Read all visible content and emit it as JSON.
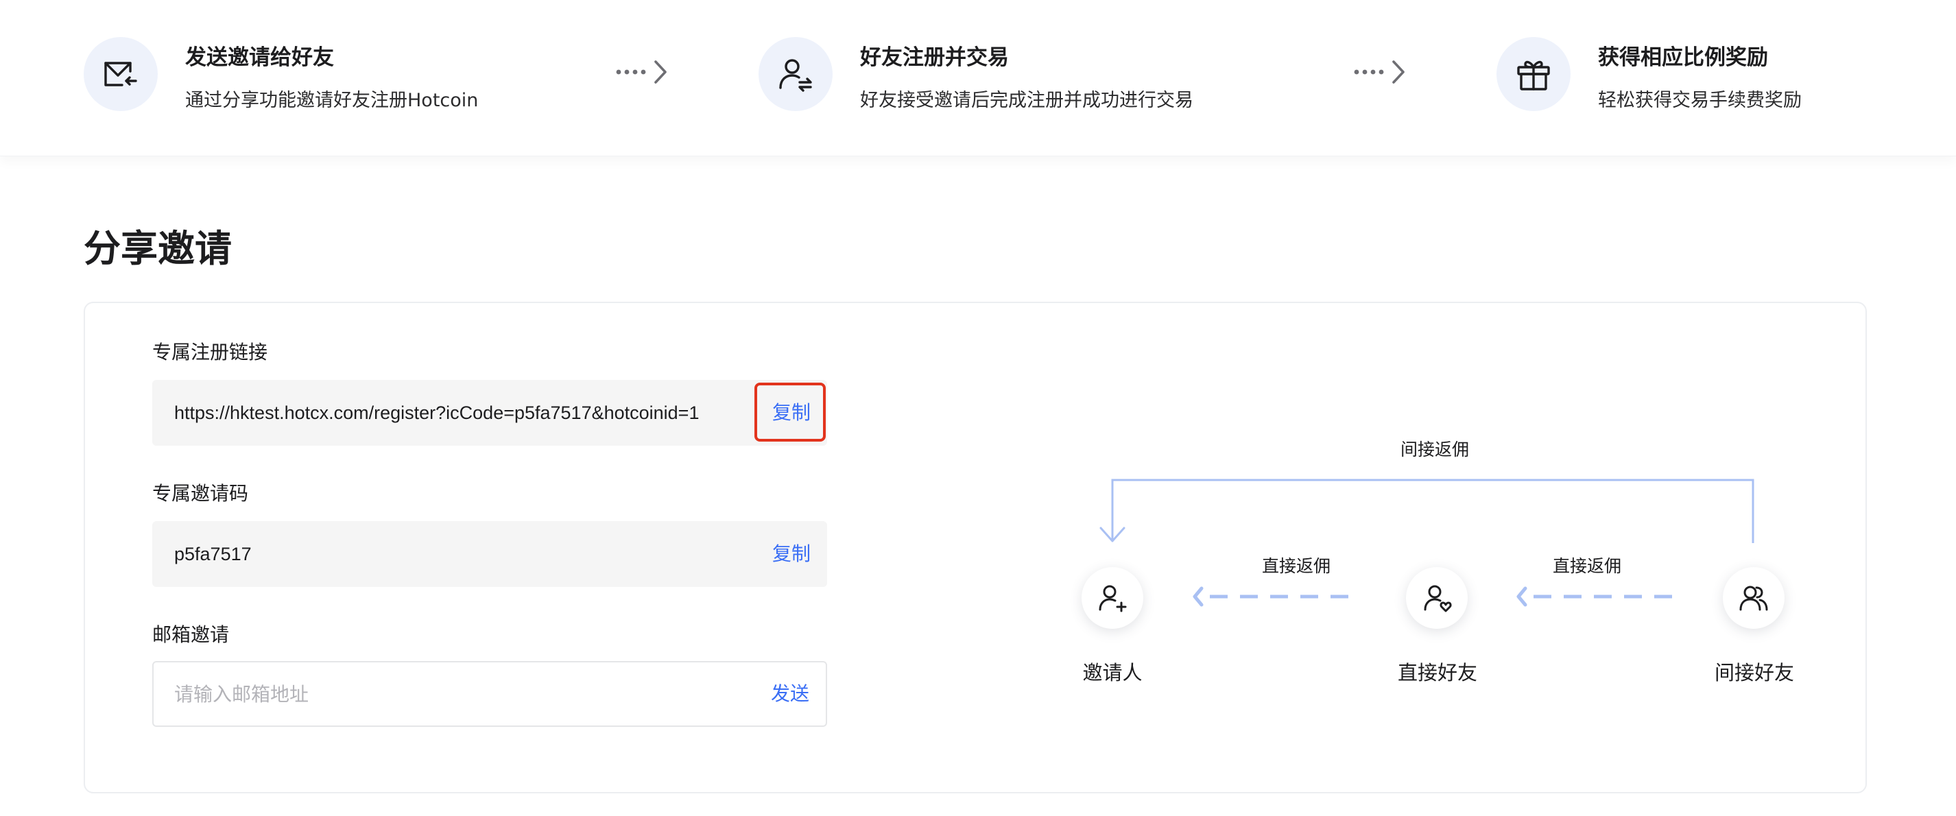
{
  "steps": [
    {
      "icon": "mail-send-icon",
      "title": "发送邀请给好友",
      "desc": "通过分享功能邀请好友注册Hotcoin"
    },
    {
      "icon": "user-exchange-icon",
      "title": "好友注册并交易",
      "desc": "好友接受邀请后完成注册并成功进行交易"
    },
    {
      "icon": "gift-icon",
      "title": "获得相应比例奖励",
      "desc": "轻松获得交易手续费奖励"
    }
  ],
  "section": {
    "title": "分享邀请"
  },
  "fields": {
    "link": {
      "label": "专属注册链接",
      "value": "https://hktest.hotcx.com/register?icCode=p5fa7517&hotcoinid=1",
      "action": "复制"
    },
    "code": {
      "label": "专属邀请码",
      "value": "p5fa7517",
      "action": "复制"
    },
    "email": {
      "label": "邮箱邀请",
      "placeholder": "请输入邮箱地址",
      "action": "发送"
    }
  },
  "diagram": {
    "indirect_rebate": "间接返佣",
    "direct_rebate_1": "直接返佣",
    "direct_rebate_2": "直接返佣",
    "nodes": [
      {
        "icon": "user-add-icon",
        "label": "邀请人"
      },
      {
        "icon": "user-heart-icon",
        "label": "直接好友"
      },
      {
        "icon": "users-icon",
        "label": "间接好友"
      }
    ]
  },
  "colors": {
    "accent": "#3a6ef5",
    "highlight": "#e2341d",
    "flow_line": "#a9c0f3",
    "icon_bg": "#eef2fb"
  }
}
